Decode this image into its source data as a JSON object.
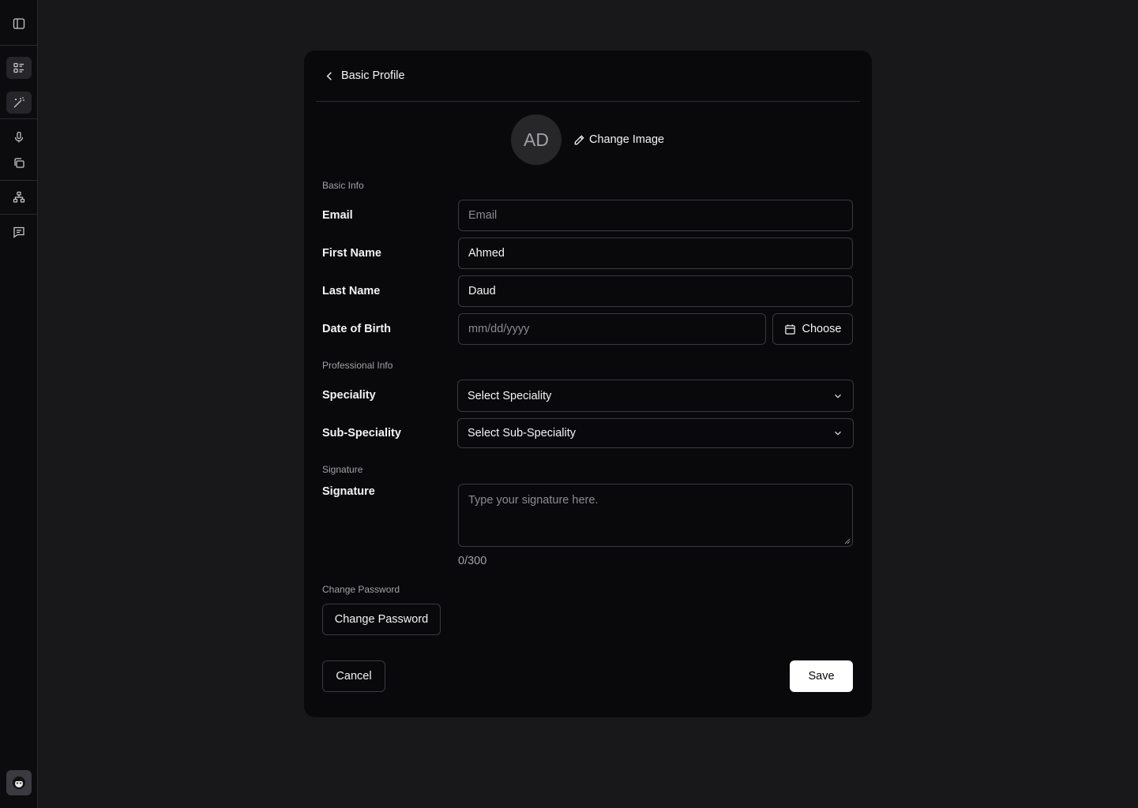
{
  "header": {
    "title": "Basic Profile"
  },
  "profile": {
    "initials": "AD",
    "change_image_label": "Change Image"
  },
  "sections": {
    "basic_info": "Basic Info",
    "professional_info": "Professional Info",
    "signature": "Signature",
    "change_password": "Change Password"
  },
  "fields": {
    "email": {
      "label": "Email",
      "value": "",
      "placeholder": "Email"
    },
    "first_name": {
      "label": "First Name",
      "value": "Ahmed"
    },
    "last_name": {
      "label": "Last Name",
      "value": "Daud"
    },
    "dob": {
      "label": "Date of Birth",
      "placeholder": "mm/dd/yyyy",
      "choose_label": "Choose"
    },
    "speciality": {
      "label": "Speciality",
      "selected": "Select Speciality"
    },
    "sub_speciality": {
      "label": "Sub-Speciality",
      "selected": "Select Sub-Speciality"
    },
    "signature": {
      "label": "Signature",
      "placeholder": "Type your signature here.",
      "counter": "0/300"
    }
  },
  "buttons": {
    "change_password": "Change Password",
    "cancel": "Cancel",
    "save": "Save"
  },
  "colors": {
    "background": "#18181a",
    "card": "#09090b",
    "border": "#3a3a40",
    "primary": "#ffffff"
  },
  "sidebar": {
    "icons": [
      "panel-toggle-icon",
      "list-icon",
      "magic-wand-icon",
      "microphone-icon",
      "copy-icon",
      "sitemap-icon",
      "message-icon",
      "user-avatar-icon"
    ]
  }
}
